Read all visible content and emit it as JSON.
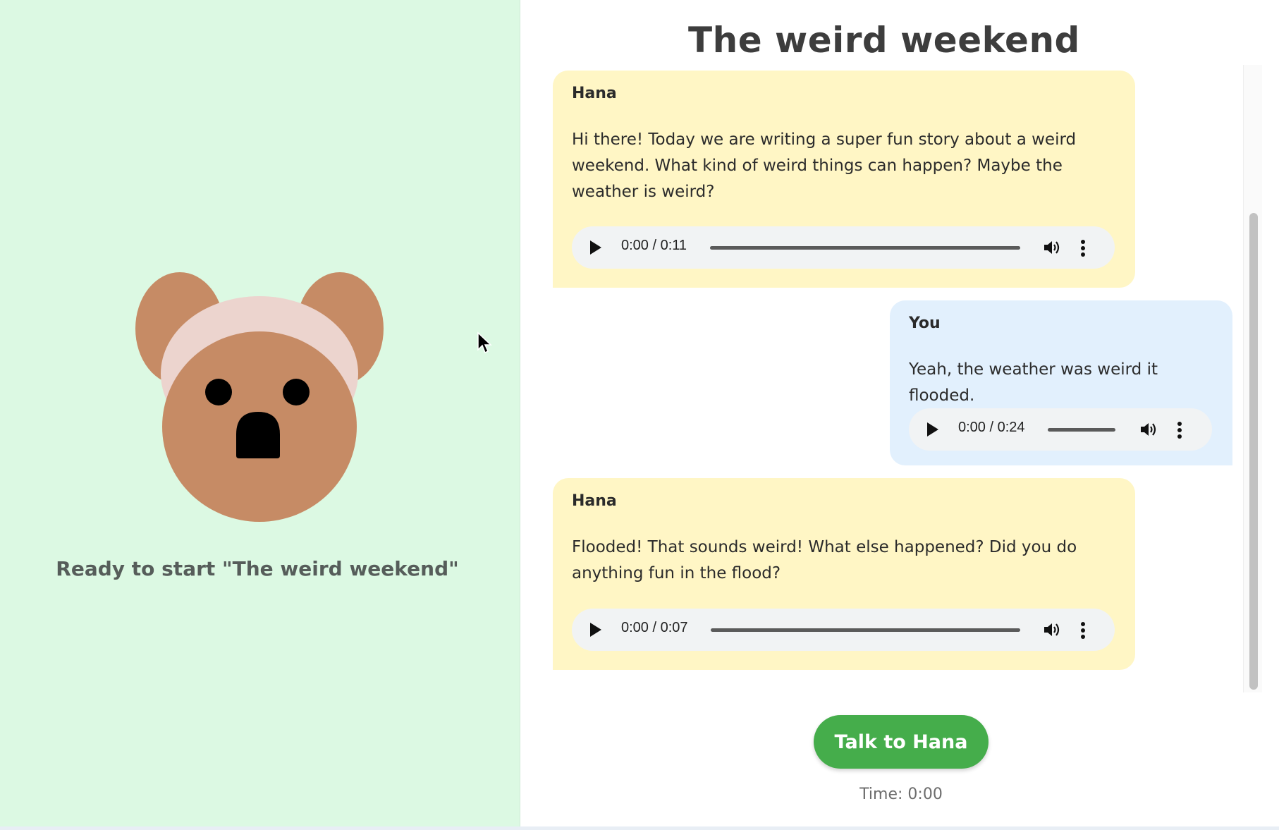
{
  "page_title": "The weird weekend",
  "left_panel": {
    "status": "Ready to start \"The weird weekend\""
  },
  "messages": [
    {
      "sender": "Hana",
      "text": "Hi there! Today we are writing a super fun story about a weird weekend. What kind of weird things can happen? Maybe the weather is weird?",
      "audio_time": "0:00 / 0:11"
    },
    {
      "sender": "You",
      "text": "Yeah, the weather was weird it flooded.",
      "audio_time": "0:00 / 0:24"
    },
    {
      "sender": "Hana",
      "text": "Flooded! That sounds weird! What else happened? Did you do anything fun in the flood?",
      "audio_time": "0:00 / 0:07"
    }
  ],
  "talk_button_label": "Talk to Hana",
  "timer": "Time: 0:00",
  "colors": {
    "left_bg": "#dcf9e3",
    "hana_bubble": "#fff6c5",
    "you_bubble": "#e2f0fd",
    "talk_button": "#45ad4b",
    "bear_fur": "#c68b65",
    "bear_headband": "#ecd4ce"
  },
  "icons": [
    "bear-avatar",
    "play-icon",
    "volume-icon",
    "more-options-icon",
    "mouse-cursor-icon"
  ]
}
